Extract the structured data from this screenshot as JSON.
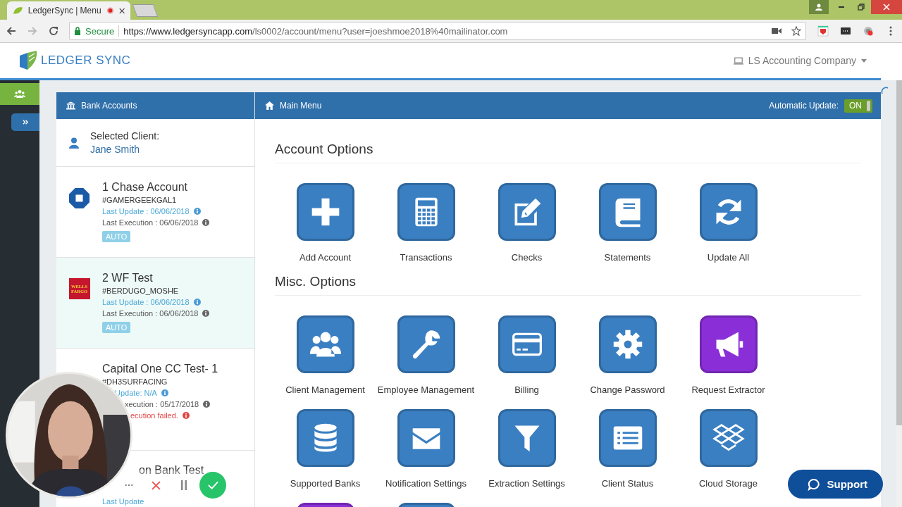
{
  "browser": {
    "tab_title": "LedgerSync | Menu",
    "secure_label": "Secure",
    "url_host": "https://www.ledgersyncapp.com",
    "url_path": "/ls0002/account/menu?user=joeshmoe2018%40mailinator.com"
  },
  "header": {
    "logo_text": "LEDGER SYNC",
    "company": "LS Accounting Company"
  },
  "left_panel": {
    "title": "Bank Accounts",
    "selected_client_label": "Selected Client:",
    "client_name": "Jane Smith",
    "accounts": [
      {
        "selected": false,
        "name": "1 Chase Account",
        "id": "#GAMERGEEKGAL1",
        "lines": [
          {
            "kind": "update",
            "text": "Last Update : 06/06/2018"
          },
          {
            "kind": "execution",
            "text": "Last Execution : 06/06/2018"
          }
        ],
        "badge": "AUTO"
      },
      {
        "logo_text": "WELLS FARGO",
        "selected": true,
        "name": "2 WF Test",
        "id": "#BERDUGO_MOSHE",
        "lines": [
          {
            "kind": "update",
            "text": "Last Update : 06/06/2018"
          },
          {
            "kind": "execution",
            "text": "Last Execution : 06/06/2018"
          }
        ],
        "badge": "AUTO"
      },
      {
        "selected": false,
        "name": "Capital One CC Test- 1",
        "id": "#DH3SURFACING",
        "lines": [
          {
            "kind": "update",
            "text": "Update: N/A"
          },
          {
            "kind": "execution",
            "text": "xecution : 05/17/2018"
          },
          {
            "kind": "error",
            "text": "ecution failed."
          }
        ]
      },
      {
        "selected": false,
        "name": "on Bank Test",
        "lines": [
          {
            "kind": "update",
            "text": "Last Update"
          }
        ]
      }
    ]
  },
  "main_panel": {
    "title": "Main Menu",
    "auto_update_label": "Automatic Update:",
    "toggle": {
      "label": "ON",
      "on": true
    },
    "sections": [
      {
        "title": "Account Options",
        "options": [
          {
            "label": "Add Account",
            "color": "#3a7fc2"
          },
          {
            "label": "Transactions",
            "color": "#3a7fc2"
          },
          {
            "label": "Checks",
            "color": "#3a7fc2"
          },
          {
            "label": "Statements",
            "color": "#3a7fc2"
          },
          {
            "label": "Update All",
            "color": "#3a7fc2"
          }
        ]
      },
      {
        "title": "Misc. Options",
        "options": [
          {
            "label": "Client Management",
            "color": "#3a7fc2"
          },
          {
            "label": "Employee Management",
            "color": "#3a7fc2"
          },
          {
            "label": "Billing",
            "color": "#3a7fc2"
          },
          {
            "label": "Change Password",
            "color": "#3a7fc2"
          },
          {
            "label": "Request Extractor",
            "color": "#8a2fd8"
          },
          {
            "label": "Supported Banks",
            "color": "#3a7fc2"
          },
          {
            "label": "Notification Settings",
            "color": "#3a7fc2"
          },
          {
            "label": "Extraction Settings",
            "color": "#3a7fc2"
          },
          {
            "label": "Client Status",
            "color": "#3a7fc2"
          },
          {
            "label": "Cloud Storage",
            "color": "#3a7fc2"
          },
          {
            "color": "#8a2fd8"
          },
          {
            "color": "#3a7fc2"
          }
        ]
      }
    ]
  },
  "support_button": {
    "label": "Support"
  }
}
